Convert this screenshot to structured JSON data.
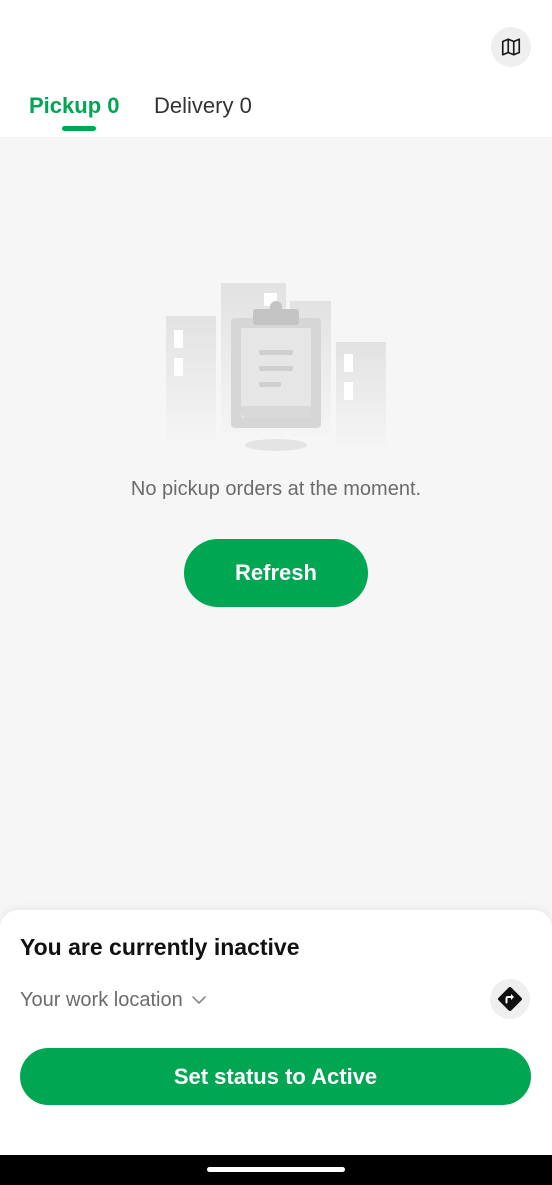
{
  "header": {
    "map_icon": "map-icon",
    "tabs": [
      {
        "label": "Pickup 0",
        "selected": true
      },
      {
        "label": "Delivery 0",
        "selected": false
      }
    ]
  },
  "empty_state": {
    "illustration_icon": "clipboard-buildings-icon",
    "message": "No pickup orders at the moment.",
    "refresh_label": "Refresh"
  },
  "status_sheet": {
    "title": "You are currently inactive",
    "location_label": "Your work location",
    "location_icon": "chevron-down-icon",
    "navigate_icon": "directions-icon",
    "action_label": "Set status to Active"
  },
  "colors": {
    "accent": "#00a651",
    "background": "#f6f6f6",
    "surface": "#ffffff",
    "muted_text": "#6b6b6b"
  }
}
